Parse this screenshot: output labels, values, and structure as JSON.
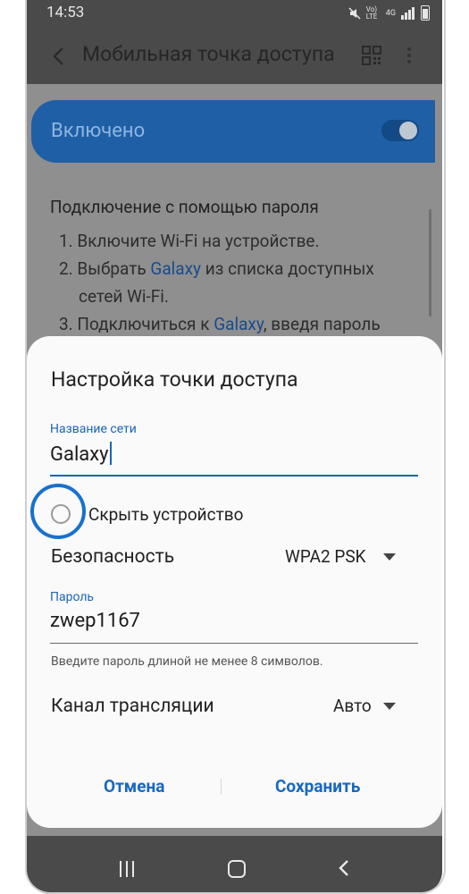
{
  "status_bar": {
    "time": "14:53",
    "lte_label": "Vo) LTE",
    "net_label": "4G"
  },
  "header": {
    "title": "Мобильная точка доступа"
  },
  "background": {
    "enabled_label": "Включено",
    "password_heading": "Подключение с помощью пароля",
    "steps": [
      {
        "pre": "1. Включите Wi-Fi на устройстве.",
        "hl": "",
        "post": ""
      },
      {
        "pre": "2. Выбрать ",
        "hl": "Galaxy",
        "post": " из списка доступных"
      },
      {
        "pre": "сетей Wi-Fi.",
        "hl": "",
        "post": ""
      },
      {
        "pre": "3. Подключиться к ",
        "hl": "Galaxy",
        "post": ", введя пароль"
      }
    ]
  },
  "dialog": {
    "title": "Настройка точки доступа",
    "network_name_label": "Название сети",
    "network_name_value": "Galaxy",
    "hide_device_label": "Скрыть устройство",
    "security_label": "Безопасность",
    "security_value": "WPA2 PSK",
    "password_label": "Пароль",
    "password_value": "zwep1167",
    "password_hint": "Введите пароль длиной не менее 8 символов.",
    "channel_label": "Канал трансляции",
    "channel_value": "Авто",
    "cancel_label": "Отмена",
    "save_label": "Сохранить"
  },
  "colors": {
    "accent": "#1a64b8",
    "highlight_ring": "#1872cc",
    "dim_background": "#8f8f8f",
    "frame": "#4a4a4a"
  }
}
